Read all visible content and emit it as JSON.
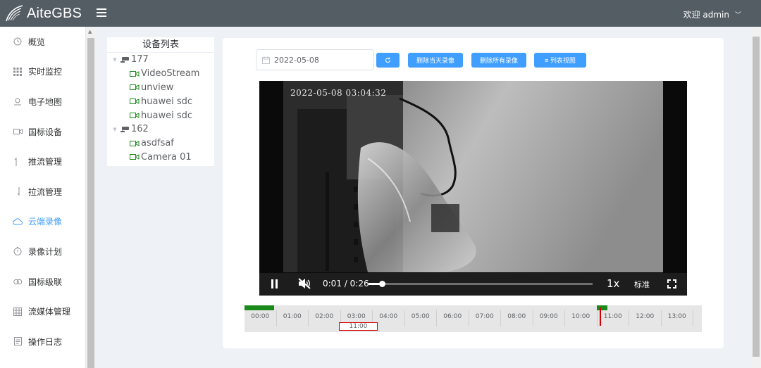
{
  "header": {
    "app_name": "AiteGBS",
    "welcome_text": "欢迎 admin"
  },
  "sidebar": {
    "items": [
      {
        "label": "概览",
        "icon": "clock-icon",
        "active": false
      },
      {
        "label": "实时监控",
        "icon": "grid-icon",
        "active": false
      },
      {
        "label": "电子地图",
        "icon": "map-pin-icon",
        "active": false
      },
      {
        "label": "国标设备",
        "icon": "video-camera-icon",
        "active": false
      },
      {
        "label": "推流管理",
        "icon": "arrow-up-icon",
        "active": false
      },
      {
        "label": "拉流管理",
        "icon": "arrow-down-icon",
        "active": false
      },
      {
        "label": "云端录像",
        "icon": "cloud-icon",
        "active": true
      },
      {
        "label": "录像计划",
        "icon": "timer-icon",
        "active": false
      },
      {
        "label": "国标级联",
        "icon": "link-icon",
        "active": false
      },
      {
        "label": "流媒体管理",
        "icon": "table-icon",
        "active": false
      },
      {
        "label": "操作日志",
        "icon": "document-icon",
        "active": false
      }
    ]
  },
  "tree": {
    "title": "设备列表",
    "groups": [
      {
        "label": "177",
        "children": [
          "VideoStream",
          "unview",
          "huawei sdc",
          "huawei sdc"
        ]
      },
      {
        "label": "162",
        "children": [
          "asdfsaf",
          "Camera 01"
        ]
      }
    ]
  },
  "toolbar": {
    "date_value": "2022-05-08",
    "delete_today_label": "删除当天录像",
    "delete_all_label": "删除所有录像",
    "list_view_label": "≡ 列表视图"
  },
  "player": {
    "timestamp_overlay": "2022-05-08  03:04:32",
    "current_time": "0:01",
    "separator": "/",
    "duration": "0:26",
    "progress_fraction": 0.06,
    "speed": "1x",
    "quality": "标准"
  },
  "timeline": {
    "ticks": [
      "00:00",
      "01:00",
      "02:00",
      "03:00",
      "04:00",
      "05:00",
      "06:00",
      "07:00",
      "08:00",
      "09:00",
      "10:00",
      "11:00",
      "12:00",
      "13:00"
    ],
    "cursor_label": "11:00",
    "colors": {
      "recording": "#1a8a1a",
      "cursor": "#d40000"
    }
  },
  "colors": {
    "accent": "#409eff",
    "header": "#545c64"
  }
}
